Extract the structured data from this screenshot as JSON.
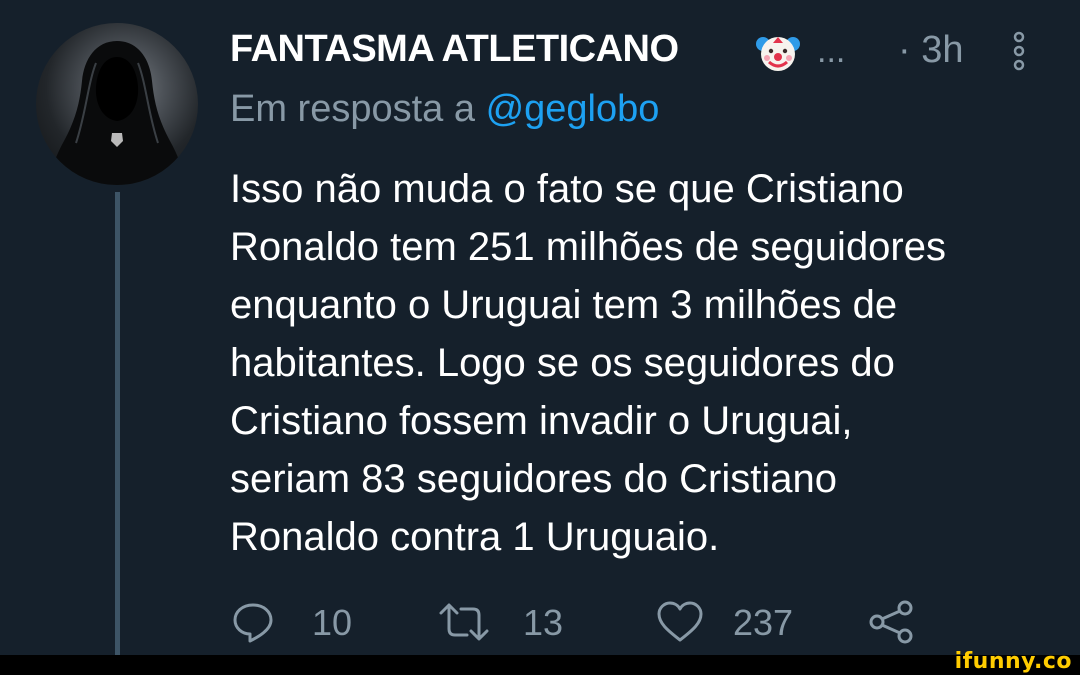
{
  "tweet": {
    "author_name": "FANTASMA ATLETICANO",
    "name_emoji": "clown-face",
    "name_truncation": "...",
    "timestamp": "· 3h",
    "reply_prefix": "Em resposta a",
    "reply_handle": "@geglobo",
    "text_lines": [
      "Isso não muda o fato se que Cristiano",
      "Ronaldo tem 251 milhões de seguidores",
      "enquanto o Uruguai tem 3 milhões de",
      "habitantes. Logo se os seguidores do",
      "Cristiano fossem invadir o Uruguai,",
      "seriam 83 seguidores do Cristiano",
      "Ronaldo contra 1 Uruguaio."
    ],
    "actions": {
      "reply_count": "10",
      "retweet_count": "13",
      "like_count": "237"
    }
  },
  "watermark": "ifunny.co",
  "colors": {
    "background": "#15202b",
    "text": "#ffffff",
    "muted": "#8899a6",
    "link": "#1da1f2",
    "thread_line": "#3d5466",
    "watermark": "#ffcc00"
  }
}
